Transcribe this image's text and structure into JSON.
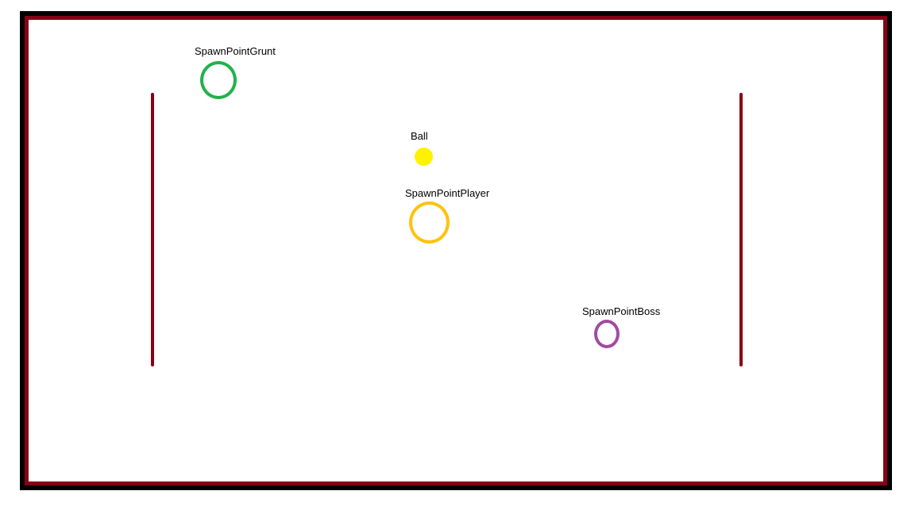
{
  "diagram": {
    "labels": {
      "grunt": "SpawnPointGrunt",
      "ball": "Ball",
      "player": "SpawnPointPlayer",
      "boss": "SpawnPointBoss"
    },
    "colors": {
      "outer_border": "#000000",
      "inner_border": "#880015",
      "walls": "#880015",
      "grunt": "#22b14c",
      "ball": "#fff200",
      "player": "#ffc20e",
      "boss": "#a349a4"
    }
  }
}
